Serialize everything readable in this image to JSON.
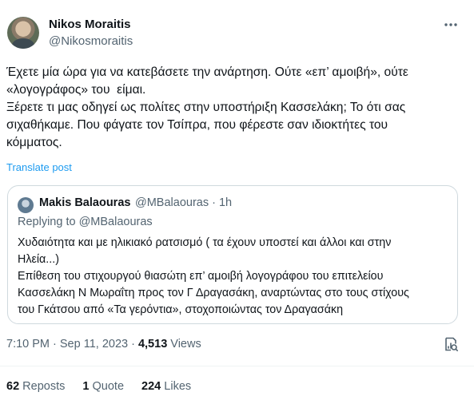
{
  "author": {
    "name": "Nikos Moraitis",
    "handle": "@Nikosmoraitis"
  },
  "tweet": {
    "text": "Έχετε μία ώρα για να κατεβάσετε την ανάρτηση. Ούτε «επ’ αμοιβή», ούτε\n«λογογράφος» του  είμαι.\nΞέρετε τι μας οδηγεί ως πολίτες στην υποστήριξη Κασσελάκη; Το ότι σας\nσιχαθήκαμε. Που φάγατε τον Τσίπρα, που φέρεστε σαν ιδιοκτήτες του\nκόμματος.",
    "translate_label": "Translate post"
  },
  "quote": {
    "name": "Makis Balaouras",
    "handle_time": "@MBalaouras · 1h",
    "replying": "Replying to @MBalaouras",
    "text": "Χυδαιότητα και με ηλικιακό ρατσισμό ( τα έχουν υποστεί και άλλοι και στην\nΗλεία...)\nΕπίθεση του στιχουργού θιασώτη επ’ αμοιβή λογογράφου του επιτελείου\nΚασσελάκη Ν Μωραΐτη προς τον Γ Δραγασάκη, αναρτώντας στο τους στίχους\nτου Γκάτσου από «Τα γερόντια», στοχοποιώντας τον Δραγασάκη"
  },
  "meta": {
    "timestamp": "7:10 PM · Sep 11, 2023 · ",
    "views_count": "4,513",
    "views_label": " Views"
  },
  "stats": {
    "reposts_count": "62",
    "reposts_label": " Reposts",
    "quote_count": "1",
    "quote_label": " Quote",
    "likes_count": "224",
    "likes_label": " Likes"
  },
  "icons": {
    "more": "more-options-icon",
    "analytics": "analytics-icon"
  },
  "colors": {
    "link": "#1d9bf0",
    "secondary_text": "#536471",
    "border": "#cfd9de"
  }
}
